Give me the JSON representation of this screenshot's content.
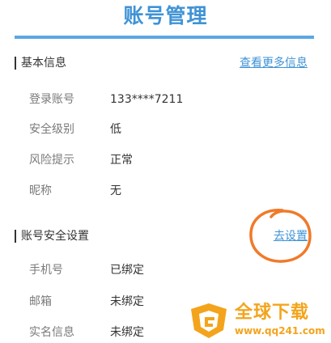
{
  "page": {
    "title": "账号管理"
  },
  "basic_info": {
    "heading": "基本信息",
    "more_link": "查看更多信息",
    "rows": [
      {
        "label": "登录账号",
        "value": "133****7211"
      },
      {
        "label": "安全级别",
        "value": "低"
      },
      {
        "label": "风险提示",
        "value": "正常"
      },
      {
        "label": "昵称",
        "value": "无"
      }
    ]
  },
  "security_settings": {
    "heading": "账号安全设置",
    "setup_link": "去设置",
    "rows": [
      {
        "label": "手机号",
        "value": "已绑定"
      },
      {
        "label": "邮箱",
        "value": "未绑定"
      },
      {
        "label": "实名信息",
        "value": "未绑定"
      }
    ]
  },
  "watermark": {
    "brand": "全球下载",
    "url": "www.qq241.com"
  },
  "colors": {
    "accent": "#3f93d6",
    "annotation": "#f07a2a",
    "watermark": "#f3a41c"
  }
}
